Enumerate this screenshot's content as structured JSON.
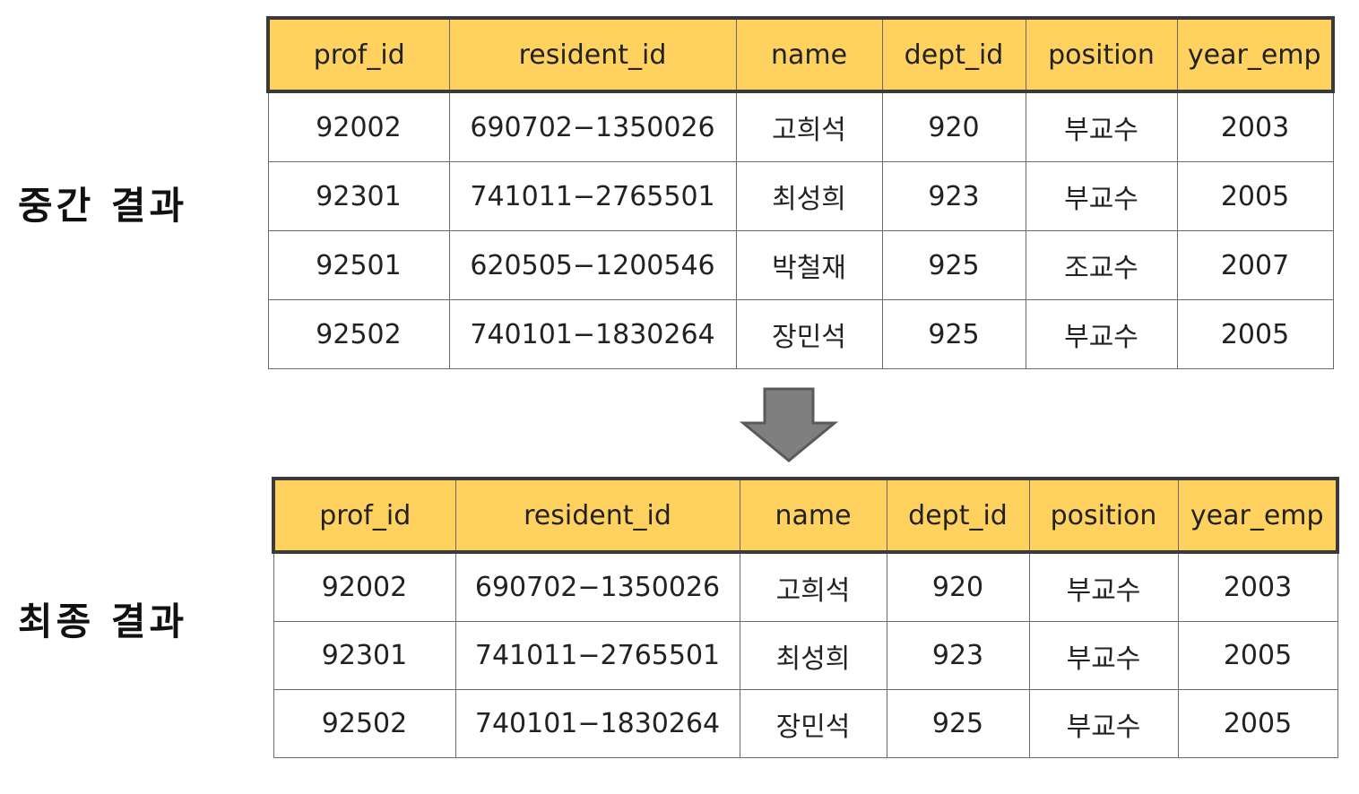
{
  "intermediate": {
    "label": "중간 결과",
    "columns": [
      "prof_id",
      "resident_id",
      "name",
      "dept_id",
      "position",
      "year_emp"
    ],
    "rows": [
      [
        "92002",
        "690702−1350026",
        "고희석",
        "920",
        "부교수",
        "2003"
      ],
      [
        "92301",
        "741011−2765501",
        "최성희",
        "923",
        "부교수",
        "2005"
      ],
      [
        "92501",
        "620505−1200546",
        "박철재",
        "925",
        "조교수",
        "2007"
      ],
      [
        "92502",
        "740101−1830264",
        "장민석",
        "925",
        "부교수",
        "2005"
      ]
    ]
  },
  "final": {
    "label": "최종 결과",
    "columns": [
      "prof_id",
      "resident_id",
      "name",
      "dept_id",
      "position",
      "year_emp"
    ],
    "rows": [
      [
        "92002",
        "690702−1350026",
        "고희석",
        "920",
        "부교수",
        "2003"
      ],
      [
        "92301",
        "741011−2765501",
        "최성희",
        "923",
        "부교수",
        "2005"
      ],
      [
        "92502",
        "740101−1830264",
        "장민석",
        "925",
        "부교수",
        "2005"
      ]
    ]
  },
  "colors": {
    "header_fill": "#ffd25f",
    "header_border": "#3a3a3a",
    "grid_line": "#6a6a6a",
    "arrow_fill": "#7f7f7f",
    "arrow_stroke": "#5a5a5a"
  }
}
